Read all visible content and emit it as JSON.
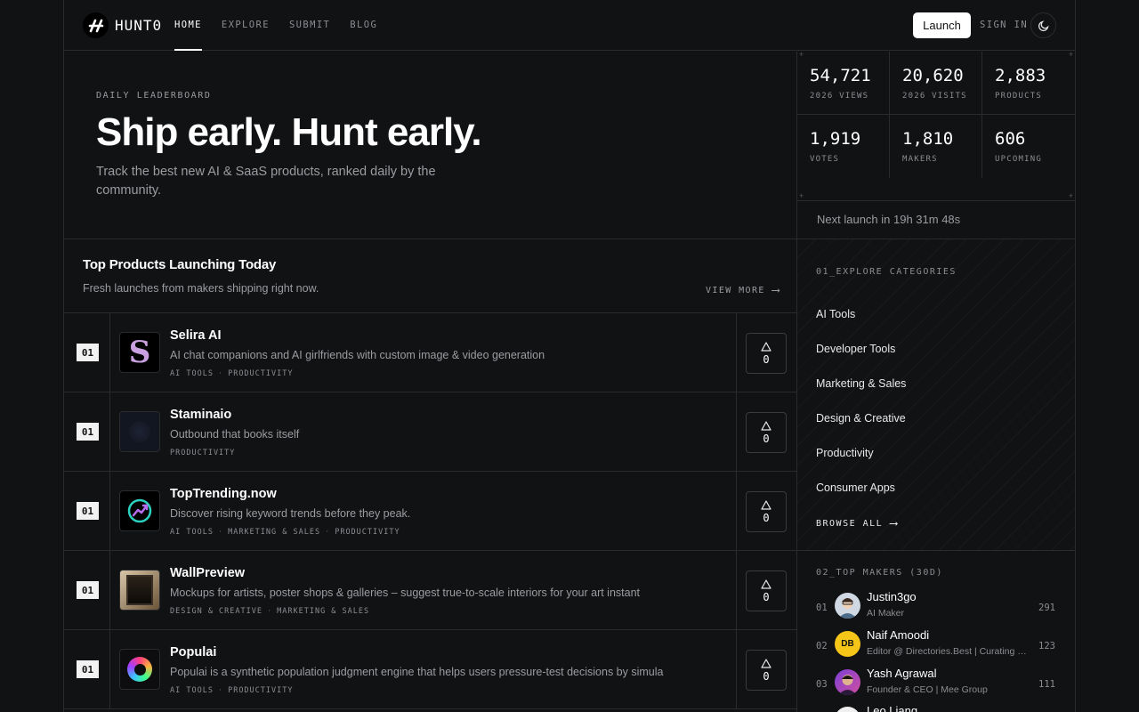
{
  "header": {
    "logo_text": "HUNT0",
    "nav": [
      "HOME",
      "EXPLORE",
      "SUBMIT",
      "BLOG"
    ],
    "launch_label": "Launch",
    "signin_label": "SIGN IN"
  },
  "hero": {
    "eyebrow": "DAILY LEADERBOARD",
    "title": "Ship early. Hunt early.",
    "subtitle": "Track the best new AI & SaaS products, ranked daily by the community."
  },
  "stats": [
    {
      "value": "54,721",
      "label": "2026 VIEWS"
    },
    {
      "value": "20,620",
      "label": "2026 VISITS"
    },
    {
      "value": "2,883",
      "label": "PRODUCTS"
    },
    {
      "value": "1,919",
      "label": "VOTES"
    },
    {
      "value": "1,810",
      "label": "MAKERS"
    },
    {
      "value": "606",
      "label": "UPCOMING"
    }
  ],
  "next_launch": "Next launch in 19h 31m 48s",
  "products_section": {
    "title": "Top Products Launching Today",
    "subtitle": "Fresh launches from makers shipping right now.",
    "view_more": "VIEW MORE"
  },
  "products": [
    {
      "rank": "01",
      "name": "Selira AI",
      "description": "AI chat companions and AI girlfriends with custom image & video generation",
      "tags": [
        "AI TOOLS",
        "PRODUCTIVITY"
      ],
      "votes": "0",
      "thumb_letter": "S"
    },
    {
      "rank": "01",
      "name": "Staminaio",
      "description": "Outbound that books itself",
      "tags": [
        "PRODUCTIVITY"
      ],
      "votes": "0"
    },
    {
      "rank": "01",
      "name": "TopTrending.now",
      "description": "Discover rising keyword trends before they peak.",
      "tags": [
        "AI TOOLS",
        "MARKETING & SALES",
        "PRODUCTIVITY"
      ],
      "votes": "0"
    },
    {
      "rank": "01",
      "name": "WallPreview",
      "description": "Mockups for artists, poster shops & galleries – suggest true-to-scale interiors for your art instant",
      "tags": [
        "DESIGN & CREATIVE",
        "MARKETING & SALES"
      ],
      "votes": "0"
    },
    {
      "rank": "01",
      "name": "Populai",
      "description": "Populai is a synthetic population judgment engine that helps users pressure-test decisions by simula",
      "tags": [
        "AI TOOLS",
        "PRODUCTIVITY"
      ],
      "votes": "0"
    }
  ],
  "categories": {
    "eyebrow": "01_EXPLORE CATEGORIES",
    "items": [
      "AI Tools",
      "Developer Tools",
      "Marketing & Sales",
      "Design & Creative",
      "Productivity",
      "Consumer Apps"
    ],
    "browse_all": "BROWSE ALL"
  },
  "makers": {
    "eyebrow": "02_TOP MAKERS (30D)",
    "items": [
      {
        "rank": "01",
        "name": "Justin3go",
        "role": "AI Maker",
        "score": "291"
      },
      {
        "rank": "02",
        "name": "Naif Amoodi",
        "role": "Editor @ Directories.Best | Curating the Best Directories",
        "score": "123",
        "initials": "DB"
      },
      {
        "rank": "03",
        "name": "Yash Agrawal",
        "role": "Founder & CEO | Mee Group",
        "score": "111"
      },
      {
        "rank": "",
        "name": "Leo Liang",
        "role": "",
        "score": ""
      }
    ]
  },
  "colors": {
    "background": "#111214",
    "border": "#2a2b2e",
    "accent": "#ffffff",
    "maker_badge": "#f5c518"
  }
}
